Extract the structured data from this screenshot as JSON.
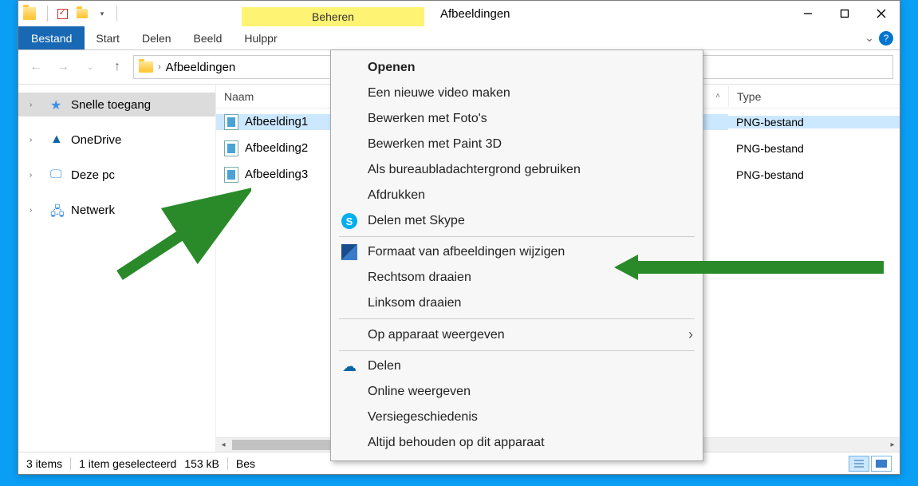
{
  "titlebar": {
    "context_tab": "Beheren",
    "title": "Afbeeldingen"
  },
  "ribbon": {
    "file": "Bestand",
    "tabs": [
      "Start",
      "Delen",
      "Beeld",
      "Hulppr"
    ]
  },
  "address": {
    "crumb": "Afbeeldingen"
  },
  "sidebar": {
    "items": [
      {
        "label": "Snelle toegang"
      },
      {
        "label": "OneDrive"
      },
      {
        "label": "Deze pc"
      },
      {
        "label": "Netwerk"
      }
    ]
  },
  "columns": {
    "name": "Naam",
    "type": "Type"
  },
  "rows": [
    {
      "name": "Afbeelding1",
      "type": "PNG-bestand",
      "selected": true
    },
    {
      "name": "Afbeelding2",
      "type": "PNG-bestand",
      "selected": false
    },
    {
      "name": "Afbeelding3",
      "type": "PNG-bestand",
      "selected": false
    }
  ],
  "statusbar": {
    "count": "3 items",
    "selection": "1 item geselecteerd",
    "size": "153 kB",
    "extra": "Bes"
  },
  "contextmenu": {
    "open": "Openen",
    "newvideo": "Een nieuwe video maken",
    "editphotos": "Bewerken met Foto's",
    "editpaint3d": "Bewerken met Paint 3D",
    "setbg": "Als bureaubladachtergrond gebruiken",
    "print": "Afdrukken",
    "skype": "Delen met Skype",
    "resize": "Formaat van afbeeldingen wijzigen",
    "rotateright": "Rechtsom draaien",
    "rotateleft": "Linksom draaien",
    "castto": "Op apparaat weergeven",
    "share": "Delen",
    "viewonline": "Online weergeven",
    "history": "Versiegeschiedenis",
    "keepdevice": "Altijd behouden op dit apparaat"
  }
}
